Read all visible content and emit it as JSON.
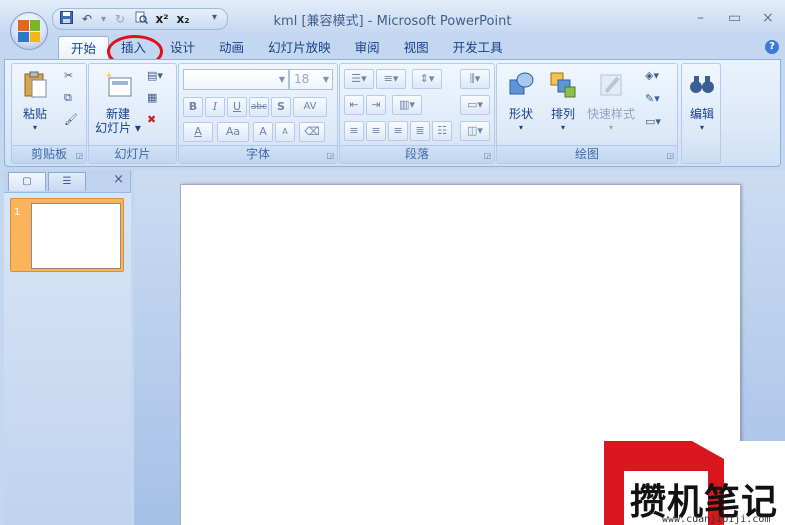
{
  "window": {
    "title": "kml [兼容模式] - Microsoft PowerPoint",
    "controls": {
      "minimize": "–",
      "maximize": "▭",
      "close": "×"
    }
  },
  "quick_access": {
    "icons": [
      "save-icon",
      "undo-icon",
      "redo-icon",
      "print-preview-icon",
      "superscript-icon",
      "subscript-icon",
      "customize-icon"
    ],
    "superscript": "x²",
    "subscript": "x₂"
  },
  "tabs": [
    {
      "label": "开始",
      "active": true
    },
    {
      "label": "插入",
      "circled": true
    },
    {
      "label": "设计"
    },
    {
      "label": "动画"
    },
    {
      "label": "幻灯片放映"
    },
    {
      "label": "审阅"
    },
    {
      "label": "视图"
    },
    {
      "label": "开发工具"
    }
  ],
  "help": "?",
  "ribbon": {
    "clipboard": {
      "label": "剪贴板",
      "paste": "粘贴"
    },
    "slides": {
      "label": "幻灯片",
      "new_slide_line1": "新建",
      "new_slide_line2": "幻灯片"
    },
    "font": {
      "label": "字体",
      "font_name": "",
      "font_size": "18",
      "bold": "B",
      "italic": "I",
      "underline": "U",
      "strike": "abc",
      "shadow": "S",
      "spacing": "AV",
      "font_color": "A",
      "change_case": "Aa",
      "grow": "A",
      "shrink": "A"
    },
    "paragraph": {
      "label": "段落"
    },
    "drawing": {
      "label": "绘图",
      "shapes": "形状",
      "arrange": "排列",
      "quick_styles": "快速样式"
    },
    "editing": {
      "label": "编辑"
    }
  },
  "left_pane": {
    "close": "×",
    "slide_number": "1"
  },
  "watermark": {
    "text": "攒机笔记",
    "url": "www.cuanjibiji.com"
  },
  "colors": {
    "accent": "#15428b",
    "selection": "#fcb45c",
    "circle": "#e2101a",
    "watermark_red": "#d9161d"
  }
}
